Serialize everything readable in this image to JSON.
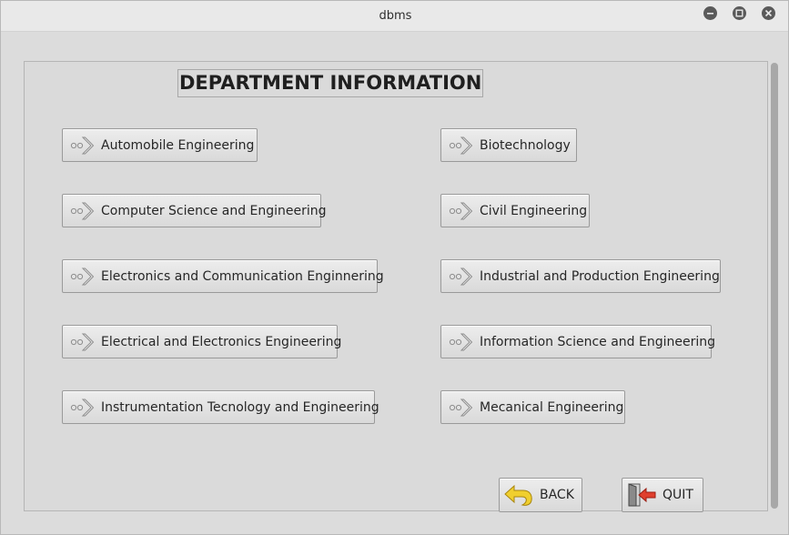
{
  "window": {
    "title": "dbms",
    "controls": [
      "minimize-icon",
      "maximize-icon",
      "close-icon"
    ]
  },
  "heading": "DEPARTMENT INFORMATION",
  "departments": {
    "left": [
      "Automobile Engineering",
      "Computer Science and Engineering",
      "Electronics and Communication Enginnering",
      "Electrical and Electronics Engineering",
      "Instrumentation Tecnology and Engineering"
    ],
    "right": [
      "Biotechnology",
      "Civil Engineering",
      "Industrial and Production Engineering",
      "Information Science and Engineering",
      "Mecanical Engineering"
    ]
  },
  "footer": {
    "back_label": "BACK",
    "quit_label": "QUIT"
  },
  "colors": {
    "background": "#dcdcdc",
    "button_border": "#9a9a9a",
    "back_arrow": "#e7c21e",
    "quit_arrow": "#d93b2b"
  }
}
